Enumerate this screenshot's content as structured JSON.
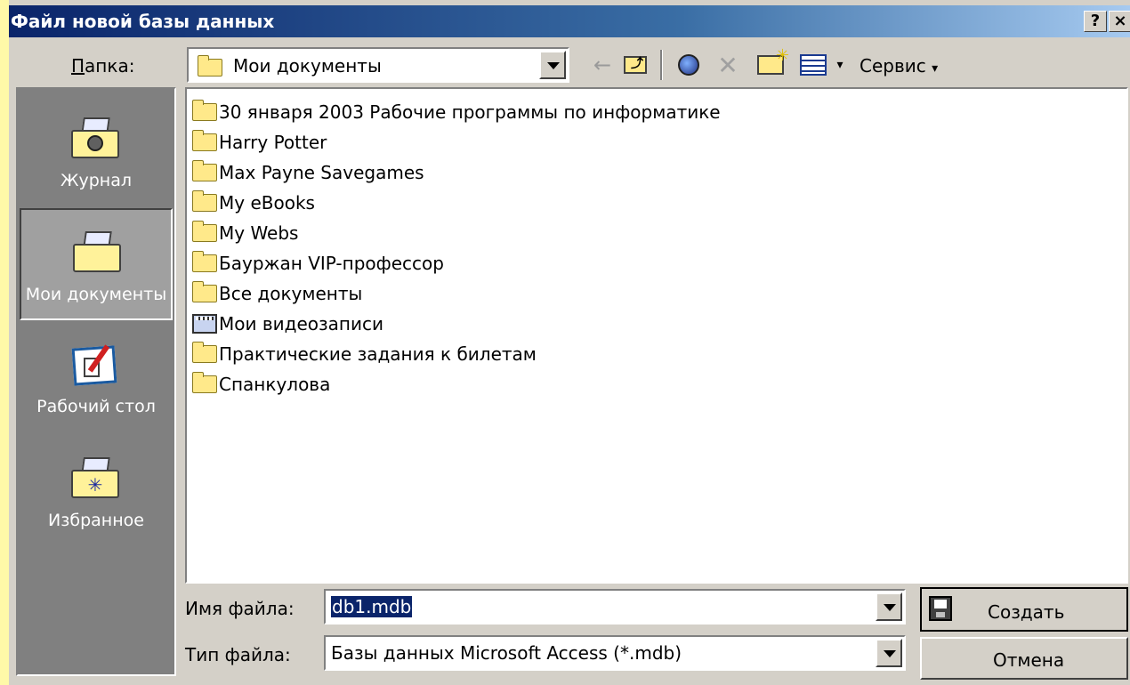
{
  "window": {
    "title": "Файл новой базы данных",
    "help_button": "?",
    "close_button": "×"
  },
  "toolbar": {
    "folder_label": "Папка:",
    "current_folder": "Мои документы",
    "tools_menu": "Сервис"
  },
  "places": [
    {
      "label": "Журнал",
      "icon": "history-folder-icon"
    },
    {
      "label": "Мои документы",
      "icon": "my-documents-folder-icon",
      "selected": true
    },
    {
      "label": "Рабочий стол",
      "icon": "desktop-icon"
    },
    {
      "label": "Избранное",
      "icon": "favorites-folder-icon"
    }
  ],
  "files": [
    {
      "name": "30 января 2003 Рабочие программы по информатике",
      "icon": "folder-icon"
    },
    {
      "name": "Harry Potter",
      "icon": "folder-icon"
    },
    {
      "name": "Max Payne Savegames",
      "icon": "folder-icon"
    },
    {
      "name": "My eBooks",
      "icon": "folder-icon"
    },
    {
      "name": "My Webs",
      "icon": "folder-icon"
    },
    {
      "name": "Бауржан VIP-профессор",
      "icon": "folder-icon"
    },
    {
      "name": "Все документы",
      "icon": "folder-icon"
    },
    {
      "name": "Мои видеозаписи",
      "icon": "video-folder-icon"
    },
    {
      "name": "Практические задания к билетам",
      "icon": "folder-icon"
    },
    {
      "name": "Спанкулова",
      "icon": "folder-icon"
    }
  ],
  "filename": {
    "label": "Имя файла:",
    "value": "db1.mdb"
  },
  "filetype": {
    "label": "Тип файла:",
    "value": "Базы данных Microsoft Access (*.mdb)"
  },
  "buttons": {
    "create": "Создать",
    "cancel": "Отмена"
  }
}
